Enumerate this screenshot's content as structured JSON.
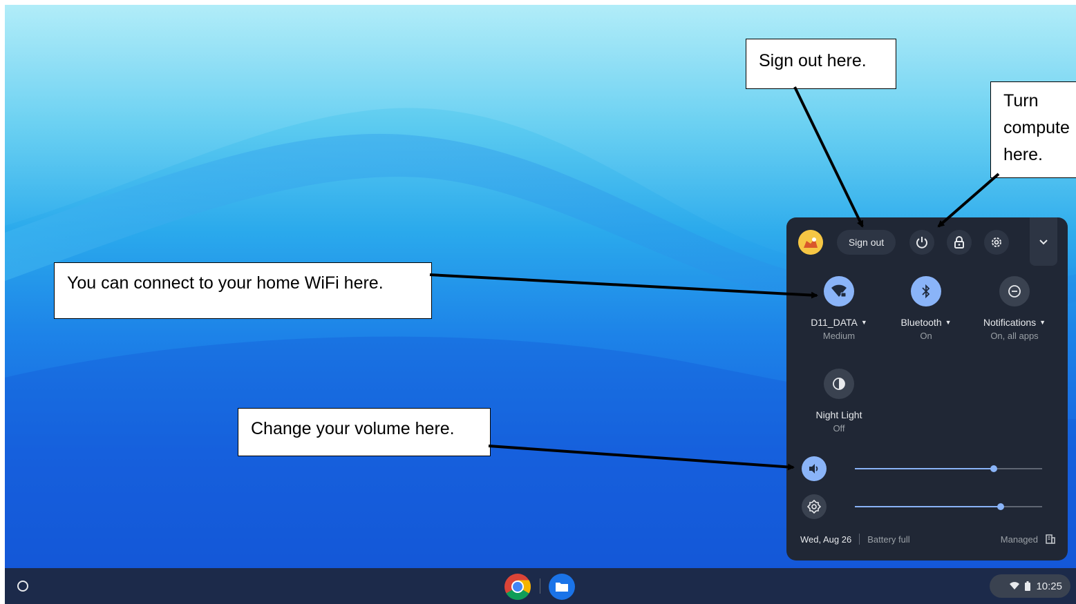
{
  "annotations": {
    "signout": "Sign out here.",
    "power_line1": "Turn",
    "power_line2": "compute",
    "power_line3": "here.",
    "wifi": "You can connect to your home WiFi here.",
    "volume": "Change your volume here."
  },
  "quick_settings": {
    "sign_out_label": "Sign out",
    "tiles": {
      "wifi": {
        "label": "D11_DATA",
        "sub": "Medium",
        "state": "on"
      },
      "bluetooth": {
        "label": "Bluetooth",
        "sub": "On",
        "state": "on"
      },
      "notifications": {
        "label": "Notifications",
        "sub": "On, all apps",
        "state": "off"
      },
      "night_light": {
        "label": "Night Light",
        "sub": "Off",
        "state": "off"
      }
    },
    "volume_level": 0.74,
    "brightness_level": 0.78,
    "footer": {
      "date": "Wed, Aug 26",
      "battery": "Battery full",
      "managed": "Managed"
    }
  },
  "shelf": {
    "time": "10:25",
    "apps": [
      "chrome-icon",
      "files-icon"
    ]
  },
  "colors": {
    "panel_bg": "#202735",
    "accent": "#8ab4f8",
    "shelf_bg": "#1c2a4a"
  }
}
